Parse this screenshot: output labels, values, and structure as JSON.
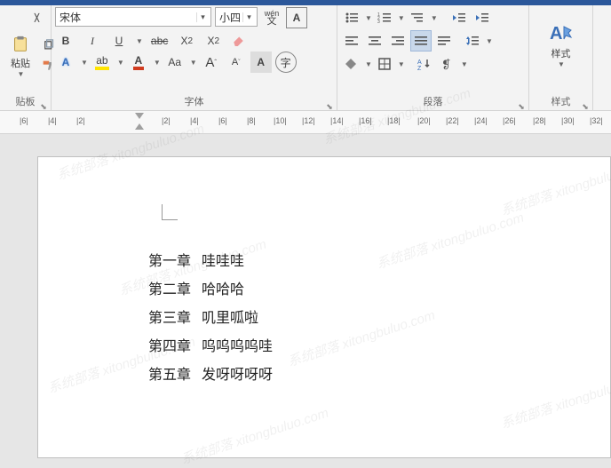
{
  "watermark": "系统部落 xitongbuluo.com",
  "ribbon": {
    "clipboard": {
      "label": "贴板",
      "paste": "粘贴"
    },
    "font": {
      "label": "字体",
      "name": "宋体",
      "size": "小四",
      "pinyin": "wén",
      "bold": "B",
      "italic": "I",
      "underline": "U",
      "strike": "abc",
      "subscript": {
        "base": "X",
        "sub": "2"
      },
      "superscript": {
        "base": "X",
        "sup": "2"
      },
      "char_border": "A",
      "highlight": "A",
      "font_color": "A",
      "case": "Aa",
      "grow": "A",
      "shrink": "A",
      "clear": "A",
      "enclose": "字"
    },
    "paragraph": {
      "label": "段落"
    },
    "styles": {
      "label": "样式",
      "button": "样式"
    }
  },
  "ruler_ticks": [
    "|6|",
    "|4|",
    "|2|",
    "",
    "|2|",
    "|4|",
    "|6|",
    "|8|",
    "|10|",
    "|12|",
    "|14|",
    "|16|",
    "|18|",
    "|20|",
    "|22|",
    "|24|",
    "|26|",
    "|28|",
    "|30|",
    "|32|"
  ],
  "document": [
    "第一章   哇哇哇",
    "第二章   哈哈哈",
    "第三章   叽里呱啦",
    "第四章   呜呜呜呜哇",
    "第五章   发呀呀呀呀"
  ]
}
